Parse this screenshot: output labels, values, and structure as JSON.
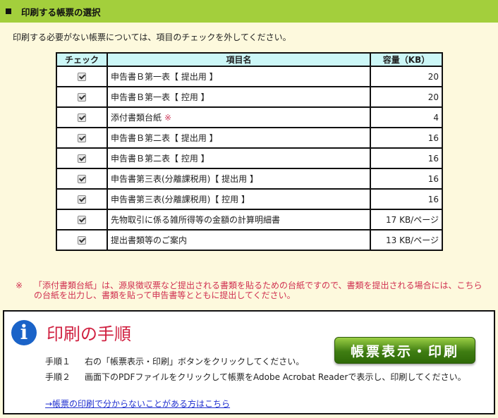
{
  "section": {
    "title": "印刷する帳票の選択"
  },
  "instruction": "印刷する必要がない帳票については、項目のチェックを外してください。",
  "table": {
    "headers": {
      "check": "チェック",
      "item": "項目名",
      "size": "容量（KB）"
    },
    "rows": [
      {
        "checked": true,
        "name": "申告書Ｂ第一表【 提出用 】",
        "mark": "",
        "size": "20"
      },
      {
        "checked": true,
        "name": "申告書Ｂ第一表【 控用 】",
        "mark": "",
        "size": "20"
      },
      {
        "checked": true,
        "name": "添付書類台紙",
        "mark": "※",
        "size": "4"
      },
      {
        "checked": true,
        "name": "申告書Ｂ第二表【 提出用 】",
        "mark": "",
        "size": "16"
      },
      {
        "checked": true,
        "name": "申告書Ｂ第二表【 控用 】",
        "mark": "",
        "size": "16"
      },
      {
        "checked": true,
        "name": "申告書第三表(分離課税用)【 提出用 】",
        "mark": "",
        "size": "16"
      },
      {
        "checked": true,
        "name": "申告書第三表(分離課税用)【 控用 】",
        "mark": "",
        "size": "16"
      },
      {
        "checked": true,
        "name": "先物取引に係る雑所得等の金額の計算明細書",
        "mark": "",
        "size": "17 KB/ページ"
      },
      {
        "checked": true,
        "name": "提出書類等のご案内",
        "mark": "",
        "size": "13 KB/ページ"
      }
    ]
  },
  "footnote": {
    "mark": "※",
    "text": "「添付書類台紙」は、源泉徴収票など提出される書類を貼るための台紙ですので、書類を提出される場合には、こちらの台紙を出力し、書類を貼って申告書等とともに提出してください。"
  },
  "procedure": {
    "icon": "info-icon",
    "icon_glyph": "i",
    "title": "印刷の手順",
    "button_label": "帳票表示・印刷",
    "steps": [
      {
        "num": "手順１",
        "text": "右の「帳票表示・印刷」ボタンをクリックしてください。"
      },
      {
        "num": "手順２",
        "text": "画面下のPDFファイルをクリックして帳票をAdobe Acrobat Readerで表示し、印刷してください。"
      }
    ],
    "help_link": "→帳票の印刷で分からないことがある方はこちら"
  },
  "colors": {
    "header_bg": "#a3cf3c",
    "page_bg": "#fdf9dd",
    "table_header_bg": "#ccf7f7",
    "note_red": "#d03050",
    "title_red": "#d02040",
    "button_green": "#3f7d12",
    "info_blue": "#1a63c8",
    "link_blue": "#2030d0"
  }
}
